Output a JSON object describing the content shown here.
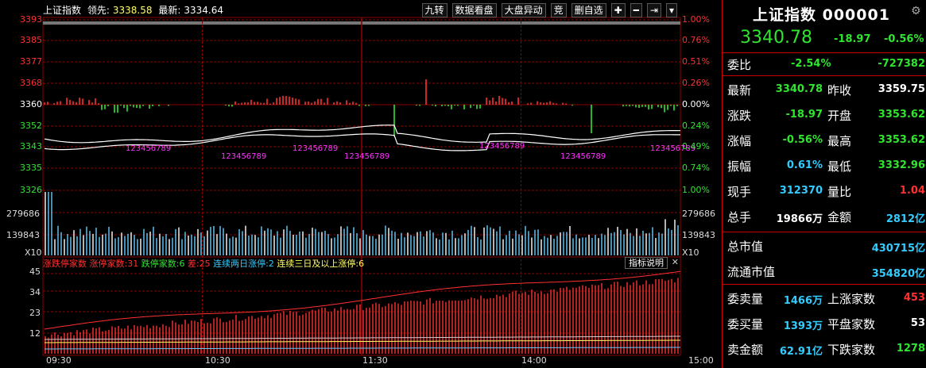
{
  "header": {
    "name": "上证指数",
    "lead_label": "领先:",
    "lead_value": "3338.58",
    "latest_label": "最新:",
    "latest_value": "3334.64",
    "buttons": [
      "九转",
      "数据看盘",
      "大盘异动",
      "竞",
      "删自选",
      "✚",
      "━",
      "⇥",
      "▾"
    ]
  },
  "price_axis": {
    "left": [
      "3393",
      "3385",
      "3377",
      "3368",
      "3360",
      "3352",
      "3343",
      "3335",
      "3326"
    ],
    "right": [
      "1.00%",
      "0.76%",
      "0.51%",
      "0.26%",
      "0.00%",
      "0.24%",
      "0.49%",
      "0.74%",
      "1.00%"
    ]
  },
  "volume_axis": {
    "top": "279686",
    "mid": "139843",
    "unit": "X10"
  },
  "indicator": {
    "name": "涨跌停家数",
    "up_label": "涨停家数:",
    "up_value": "31",
    "down_label": "跌停家数:",
    "down_value": "6",
    "diff_label": "差:",
    "diff_value": "25",
    "two_label": "连续两日涨停:",
    "two_value": "2",
    "three_label": "连续三日及以上涨停:",
    "three_value": "6",
    "help": "指标说明",
    "close": "✕",
    "axis": [
      "45",
      "34",
      "23",
      "12"
    ]
  },
  "time_axis": [
    "09:30",
    "10:30",
    "11:30",
    "14:00",
    "15:00"
  ],
  "nine_turn_marks": [
    "123456789",
    "123456789",
    "123456789",
    "123456789",
    "123456789",
    "123456789",
    "123456789"
  ],
  "side": {
    "title": "上证指数 000001",
    "price": "3340.78",
    "change": "-18.97",
    "change_pct": "-0.56%",
    "wei_bi_label": "委比",
    "wei_bi_pct": "-2.54%",
    "wei_bi_val": "-727382",
    "rows": [
      {
        "k": "最新",
        "v": "3340.78",
        "k2": "昨收",
        "v2": "3359.75",
        "c": "#2fe52f",
        "c2": "#fff"
      },
      {
        "k": "涨跌",
        "v": "-18.97",
        "k2": "开盘",
        "v2": "3353.62",
        "c": "#2fe52f",
        "c2": "#2fe52f"
      },
      {
        "k": "涨幅",
        "v": "-0.56%",
        "k2": "最高",
        "v2": "3353.62",
        "c": "#2fe52f",
        "c2": "#2fe52f"
      },
      {
        "k": "振幅",
        "v": "0.61%",
        "k2": "最低",
        "v2": "3332.96",
        "c": "#33ccff",
        "c2": "#2fe52f"
      },
      {
        "k": "现手",
        "v": "312370",
        "k2": "量比",
        "v2": "1.04",
        "c": "#33ccff",
        "c2": "#ff3030"
      },
      {
        "k": "总手",
        "v": "19866万",
        "k2": "金额",
        "v2": "2812亿",
        "c": "#fff",
        "c2": "#33ccff"
      }
    ],
    "mktcap_label": "总市值",
    "mktcap_value": "430715亿",
    "float_label": "流通市值",
    "float_value": "354820亿",
    "rows2": [
      {
        "k": "委卖量",
        "v": "1466万",
        "k2": "上涨家数",
        "v2": "453",
        "c": "#33ccff",
        "c2": "#ff3030"
      },
      {
        "k": "委买量",
        "v": "1393万",
        "k2": "平盘家数",
        "v2": "53",
        "c": "#33ccff",
        "c2": "#fff"
      },
      {
        "k": "卖金额",
        "v": "62.91亿",
        "k2": "下跌家数",
        "v2": "1278",
        "c": "#33ccff",
        "c2": "#2fe52f"
      }
    ]
  },
  "colors": {
    "up": "#ff3030",
    "down": "#2fe52f",
    "grid": "#8b0000",
    "price_line": "#ffffff",
    "avg_line": "#ffff66",
    "vol_bar": "#66ccff",
    "magenta": "#ff33ff"
  }
}
